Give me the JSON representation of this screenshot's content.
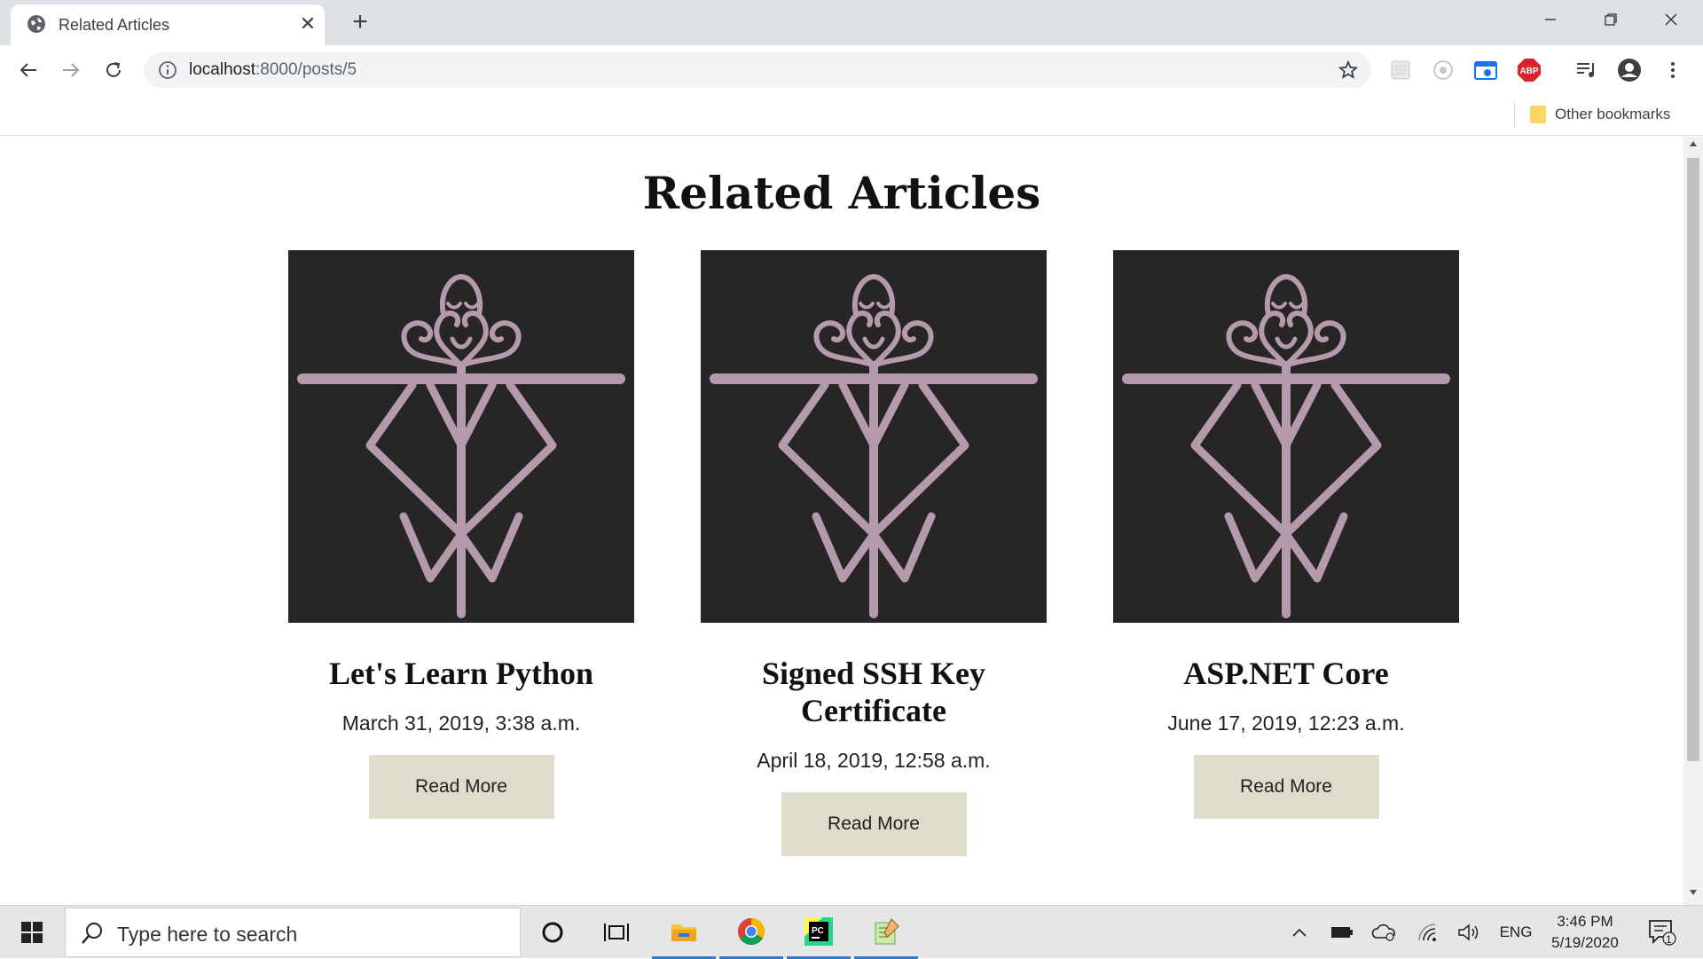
{
  "browser": {
    "tab_title": "Related Articles",
    "url_host": "localhost",
    "url_path": ":8000/posts/5",
    "bookmarks": {
      "other_label": "Other bookmarks"
    }
  },
  "page": {
    "heading": "Related Articles",
    "articles": [
      {
        "title": "Let's Learn Python",
        "date": "March 31, 2019, 3:38 a.m.",
        "button": "Read More"
      },
      {
        "title": "Signed SSH Key Certificate",
        "date": "April 18, 2019, 12:58 a.m.",
        "button": "Read More"
      },
      {
        "title": "ASP.NET Core",
        "date": "June 17, 2019, 12:23 a.m.",
        "button": "Read More"
      }
    ]
  },
  "taskbar": {
    "search_placeholder": "Type here to search",
    "language": "ENG",
    "time": "3:46 PM",
    "date": "5/19/2020",
    "notification_count": "1"
  },
  "colors": {
    "card_image_bg": "#272624",
    "symbol_color": "#b59aad",
    "button_bg": "#e0dccb",
    "tabstrip_bg": "#dee1e6",
    "abp_red": "#d8232a"
  }
}
